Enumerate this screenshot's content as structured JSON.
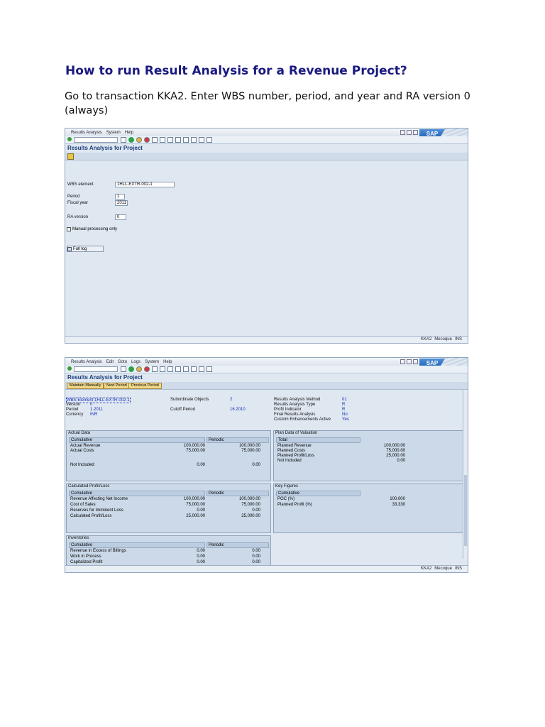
{
  "doc": {
    "title": "How to run Result Analysis for a Revenue Project?",
    "intro": "Go to transaction KKA2. Enter WBS number, period, and year and RA version 0 (always)"
  },
  "screen1": {
    "menu": [
      "Results Analysis",
      "System",
      "Help"
    ],
    "title": "Results Analysis for Project",
    "fields": {
      "wbs_label": "WBS element",
      "wbs_value": "1HLL-EXTR-002-1",
      "period_label": "Period",
      "period_value": "1",
      "year_label": "Fiscal year",
      "year_value": "2011",
      "ra_label": "RA version",
      "ra_value": "0",
      "manual_label": "Manual processing only",
      "fulllog_label": "Full log"
    },
    "status": [
      "KKA2",
      "Mecoque",
      "INS"
    ]
  },
  "screen2": {
    "menu": [
      "Results Analysis",
      "Edit",
      "Goto",
      "Logs",
      "System",
      "Help"
    ],
    "title": "Results Analysis for Project",
    "buttons": [
      "Maintain Manually",
      "Next Period",
      "Previous Period"
    ],
    "header": {
      "wbs": "WBS Element 1HLL-EXTR-002-1",
      "version_label": "Version",
      "version_value": "0",
      "period_label": "Period",
      "period_value": "1.2011",
      "currency_label": "Currency",
      "currency_value": "INR",
      "sub_label": "Subordinate Objects",
      "sub_value": "2",
      "cutoff_label": "Cutoff Period",
      "cutoff_value": "16.2010",
      "ram_label": "Results Analysis Method",
      "ram_value": "01",
      "rat_label": "Results Analysis Type",
      "rat_value": "R",
      "pi_label": "Profit Indicator",
      "pi_value": "R",
      "fra_label": "Final Results Analysis",
      "fra_value": "No",
      "cea_label": "Custom Enhancements Active",
      "cea_value": "Yes"
    },
    "actual": {
      "title": "Actual Data",
      "cum": "Cumulative",
      "per": "Periodic",
      "rows": [
        {
          "name": "Actual Revenue",
          "cum": "100,000.00",
          "per": "100,000.00"
        },
        {
          "name": "Actual Costs",
          "cum": "75,000.00",
          "per": "75,000.00"
        },
        {
          "name": "Not Included",
          "cum": "0.00",
          "per": "0.00"
        }
      ]
    },
    "plan": {
      "title": "Plan Data of Valuation",
      "total": "Total",
      "rows": [
        {
          "name": "Planned Revenue",
          "val": "100,000.00"
        },
        {
          "name": "Planned Costs",
          "val": "75,000.00"
        },
        {
          "name": "Planned Profit/Loss",
          "val": "25,000.00"
        },
        {
          "name": "Not Included",
          "val": "0.00"
        }
      ]
    },
    "calc": {
      "title": "Calculated Profit/Loss",
      "cum": "Cumulative",
      "per": "Periodic",
      "rows": [
        {
          "name": "Revenue Affecting Net Income",
          "cum": "100,000.00",
          "per": "100,000.00"
        },
        {
          "name": "Cost of Sales",
          "cum": "75,000.00",
          "per": "75,000.00"
        },
        {
          "name": "Reserves for Imminent Loss",
          "cum": "0.00",
          "per": "0.00"
        },
        {
          "name": "Calculated Profit/Loss",
          "cum": "25,000.00",
          "per": "25,000.00"
        }
      ]
    },
    "key": {
      "title": "Key Figures",
      "cum": "Cumulative",
      "rows": [
        {
          "name": "POC (%)",
          "val": "100.000"
        },
        {
          "name": "Planned Profit (%)",
          "val": "33.330"
        }
      ]
    },
    "inv": {
      "title": "Inventories",
      "cum": "Cumulative",
      "per": "Periodic",
      "rows": [
        {
          "name": "Revenue in Excess of Billings",
          "cum": "0.00",
          "per": "0.00"
        },
        {
          "name": "Work in Process",
          "cum": "0.00",
          "per": "0.00"
        },
        {
          "name": "Capitalized Profit",
          "cum": "0.00",
          "per": "0.00"
        }
      ]
    },
    "status": [
      "KKA2",
      "Mecoque",
      "INS"
    ]
  }
}
